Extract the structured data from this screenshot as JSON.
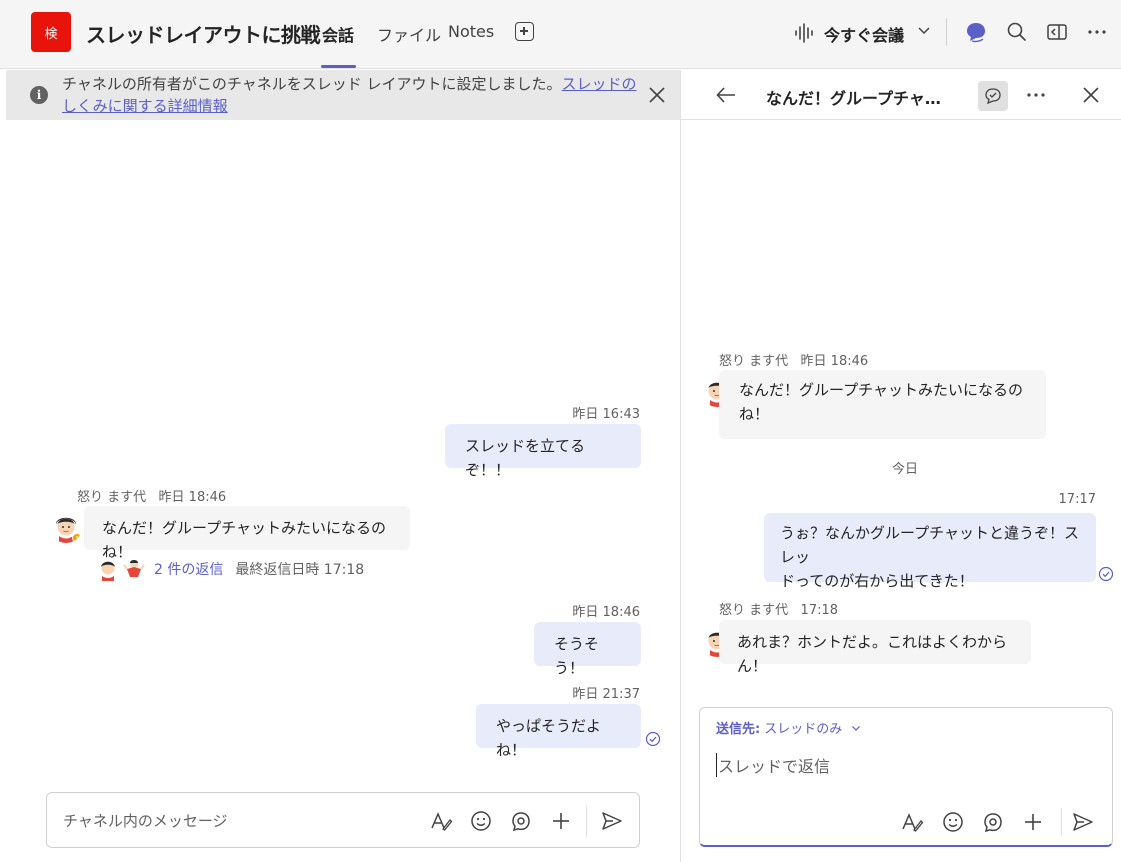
{
  "header": {
    "team_initial": "検",
    "channel_title": "スレッドレイアウトに挑戦",
    "tabs": [
      {
        "label": "会話",
        "active": true
      },
      {
        "label": "ファイル",
        "active": false
      },
      {
        "label": "Notes",
        "active": false
      }
    ],
    "meet_label": "今すぐ会議",
    "icons": [
      "meet-wave-icon",
      "chevron-down-icon",
      "chat-icon",
      "search-icon",
      "panel-icon",
      "more-icon"
    ]
  },
  "banner": {
    "text": "チャネルの所有者がこのチャネルをスレッド レイアウトに設定しました。",
    "link": "スレッドのしくみに関する詳細情報"
  },
  "main": {
    "messages": [
      {
        "timestamp": "昨日 16:43",
        "text": "スレッドを立てるぞ！！",
        "mine": true
      },
      {
        "sender": "怒り ます代",
        "timestamp": "昨日 18:46",
        "text": "なんだ！グループチャットみたいになるのね！",
        "mine": false
      },
      {
        "timestamp": "昨日 18:46",
        "text": "そうそう！",
        "mine": true
      },
      {
        "timestamp": "昨日 21:37",
        "text": "やっぱそうだよね！",
        "mine": true
      }
    ],
    "replies": {
      "count_label": "2 件の返信",
      "last_reply": "最終返信日時 17:18"
    },
    "composer_placeholder": "チャネル内のメッセージ"
  },
  "thread": {
    "title": "なんだ！グループチャット...",
    "messages": [
      {
        "sender": "怒り ます代",
        "timestamp": "昨日 18:46",
        "text_lines": [
          "なんだ！グループチャットみたいになるの",
          "ね！"
        ],
        "mine": false
      },
      {
        "timestamp": "17:17",
        "text_lines": [
          "うぉ？なんかグループチャットと違うぞ！スレッ",
          "ドってのが右から出てきた！"
        ],
        "mine": true
      },
      {
        "sender": "怒り ます代",
        "timestamp": "17:18",
        "text_lines": [
          "あれま？ホントだよ。これはよくわからん！"
        ],
        "mine": false
      }
    ],
    "day_separator": "今日",
    "composer": {
      "to_label": "送信先:",
      "to_value": "スレッドのみ",
      "placeholder": "スレッドで返信"
    }
  },
  "colors": {
    "accent": "#5b5fc7",
    "team_tile": "#e8140c",
    "my_bubble": "#e8ebfa",
    "other_bubble": "#f5f5f5"
  }
}
